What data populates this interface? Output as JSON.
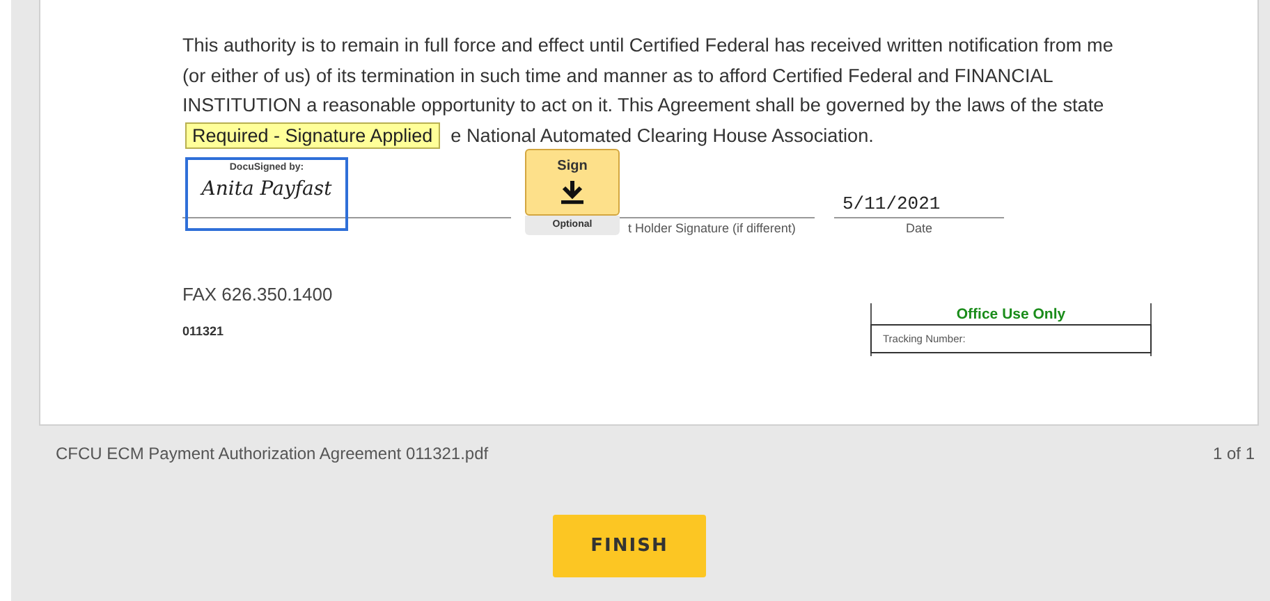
{
  "document": {
    "paragraph": "This authority is to remain in full force and effect until Certified Federal has received written notification from me (or either of us) of its termination in such time and manner as to afford Certified Federal and FINANCIAL INSTITUTION a reasonable opportunity to act on it. This Agreement shall be governed by the laws of the state",
    "paragraph_tail": "e National Automated Clearing House Association.",
    "tooltip": "Required - Signature Applied",
    "signature": {
      "header": "DocuSigned by:",
      "name": "Anita Payfast"
    },
    "sign_tab": {
      "label": "Sign",
      "footer": "Optional"
    },
    "second_signature_label": "t Holder Signature (if different)",
    "date": {
      "value": "5/11/2021",
      "label": "Date"
    },
    "fax": "FAX 626.350.1400",
    "code": "011321",
    "office": {
      "title": "Office Use Only",
      "field": "Tracking Number:"
    }
  },
  "footer": {
    "filename": "CFCU ECM Payment Authorization Agreement 011321.pdf",
    "pages": "1 of 1"
  },
  "finish_button": "FINISH"
}
